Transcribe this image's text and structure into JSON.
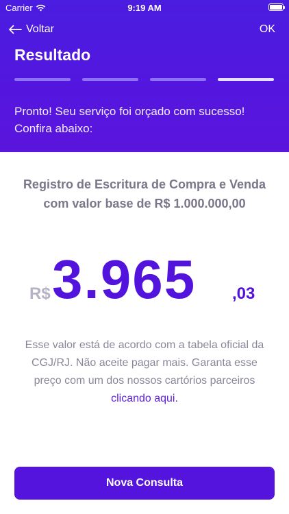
{
  "status_bar": {
    "carrier": "Carrier",
    "time": "9:19 AM"
  },
  "nav": {
    "back_label": "Voltar",
    "ok_label": "OK"
  },
  "header": {
    "title": "Resultado",
    "steps_total": 4,
    "current_step": 4,
    "message": "Pronto! Seu serviço foi orçado com sucesso! Confira abaixo:"
  },
  "result": {
    "service_description": "Registro de Escritura de Compra e Venda com valor base de R$ 1.000.000,00",
    "currency": "R$",
    "amount": "3.965",
    "cents": ",03",
    "info_text": "Esse valor está de acordo com a tabela oficial da CGJ/RJ. Não aceite pagar mais. Garanta esse preço com um dos nossos cartórios parceiros",
    "link_text": "clicando aqui."
  },
  "actions": {
    "new_query_label": "Nova Consulta"
  },
  "colors": {
    "primary": "#5214dc",
    "header_bg": "#4a1de0",
    "muted_text": "#8a8699",
    "link": "#5e1fd9"
  },
  "icons": {
    "back": "arrow-left-icon",
    "wifi": "wifi-icon",
    "battery": "battery-icon"
  }
}
